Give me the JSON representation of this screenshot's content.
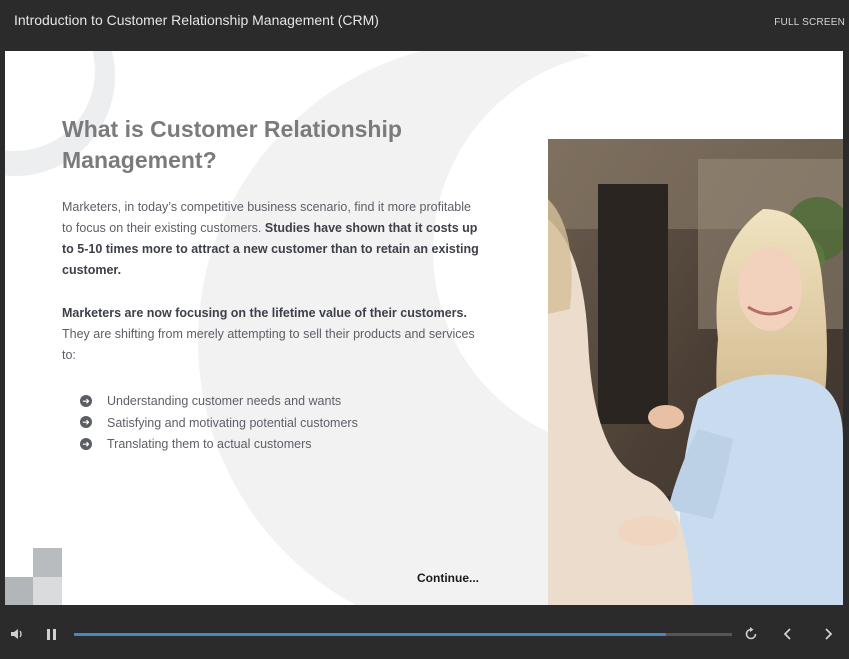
{
  "header": {
    "course_title": "Introduction to Customer Relationship Management (CRM)",
    "fullscreen_label": "FULL SCREEN"
  },
  "slide": {
    "heading": "What is Customer Relationship Management?",
    "para1_normal": "Marketers, in today’s competitive business scenario, find it more profitable to focus on their existing customers. ",
    "para1_bold": "Studies have shown that it costs up to 5-10 times more to attract a new customer than to retain an existing customer.",
    "para2_bold": "Marketers are now focusing on the lifetime value of their customers.",
    "para2_normal": " They are shifting from merely attempting to sell their products and services to:",
    "bullets": [
      "Understanding customer needs and wants",
      "Satisfying and motivating potential customers",
      "Translating them to actual customers"
    ],
    "bullet_icon": "arrow-circle-icon",
    "photo_subject": "businesswoman-handshake-photo",
    "continue_label": "Continue..."
  },
  "player": {
    "progress_fraction": 0.9,
    "accent_color": "#4a85c2",
    "icons": [
      "volume-icon",
      "pause-icon",
      "replay-icon",
      "chevron-left-icon",
      "chevron-right-icon"
    ]
  }
}
